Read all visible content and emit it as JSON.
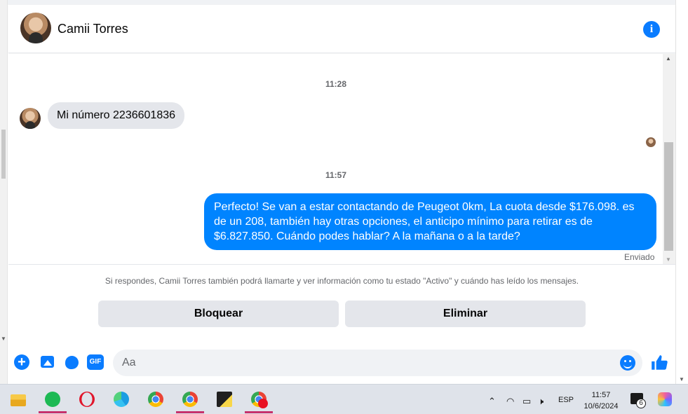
{
  "conversation": {
    "contact_name": "Camii Torres",
    "info_icon": "info-icon"
  },
  "messages": {
    "timestamp_1": "11:28",
    "incoming_1": "Mi número 2236601836",
    "timestamp_2": "11:57",
    "outgoing_1": "Perfecto!  Se van a estar contactando de Peugeot 0km, La cuota desde $176.098. es de un 208, también hay otras opciones, el anticipo mínimo para retirar es de $6.827.850. Cuándo podes hablar? A la mañana o a la tarde?",
    "sent_status": "Enviado"
  },
  "notice": {
    "text": "Si respondes, Camii Torres también podrá llamarte y ver información como tu estado \"Activo\" y cuándo has leído los mensajes.",
    "block_label": "Bloquear",
    "delete_label": "Eliminar"
  },
  "composer": {
    "placeholder": "Aa",
    "gif_label": "GIF",
    "plus_label": "+"
  },
  "taskbar": {
    "apps": [
      "file-explorer-icon",
      "spotify-icon",
      "opera-icon",
      "edge-icon",
      "chrome-icon",
      "chrome-profile-icon",
      "sticky-notes-icon",
      "chrome-red-icon"
    ],
    "language": "ESP",
    "time": "11:57",
    "date": "10/6/2024",
    "notification_count": "6"
  },
  "colors": {
    "accent": "#0a7cff",
    "outgoing_bubble": "#0084ff",
    "incoming_bubble": "#e4e6eb",
    "taskbar": "#dfe3ea",
    "active_indicator": "#c6306b"
  }
}
